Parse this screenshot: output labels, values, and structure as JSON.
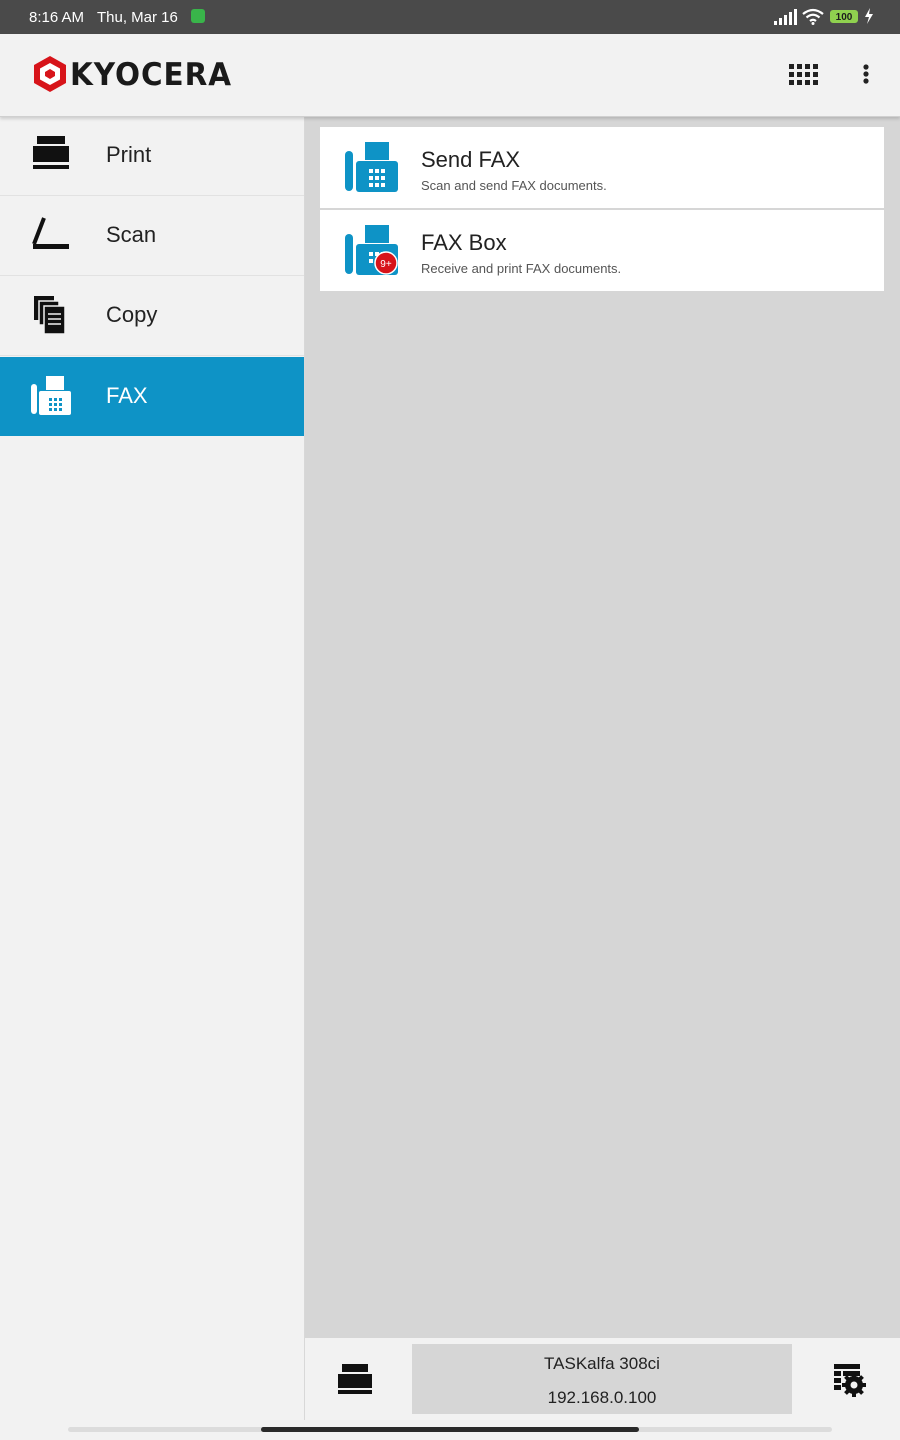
{
  "status_bar": {
    "time": "8:16 AM",
    "date": "Thu, Mar 16",
    "battery": "100"
  },
  "header": {
    "brand": "KYOCERA",
    "apps_icon": "grid-icon",
    "menu_icon": "more-vert-icon"
  },
  "sidebar": {
    "items": [
      {
        "label": "Print",
        "icon": "printer-icon"
      },
      {
        "label": "Scan",
        "icon": "scanner-icon"
      },
      {
        "label": "Copy",
        "icon": "copy-icon"
      },
      {
        "label": "FAX",
        "icon": "fax-icon",
        "active": true
      }
    ]
  },
  "main": {
    "cards": [
      {
        "title": "Send FAX",
        "description": "Scan and send FAX documents.",
        "icon": "fax-icon"
      },
      {
        "title": "FAX Box",
        "description": "Receive and print FAX documents.",
        "icon": "fax-icon",
        "badge": "9+"
      }
    ]
  },
  "footer": {
    "device_name": "TASKalfa 308ci",
    "device_ip": "192.168.0.100"
  },
  "colors": {
    "accent": "#0e93c6",
    "badge": "#d7141a",
    "logo_red": "#d7141a"
  }
}
